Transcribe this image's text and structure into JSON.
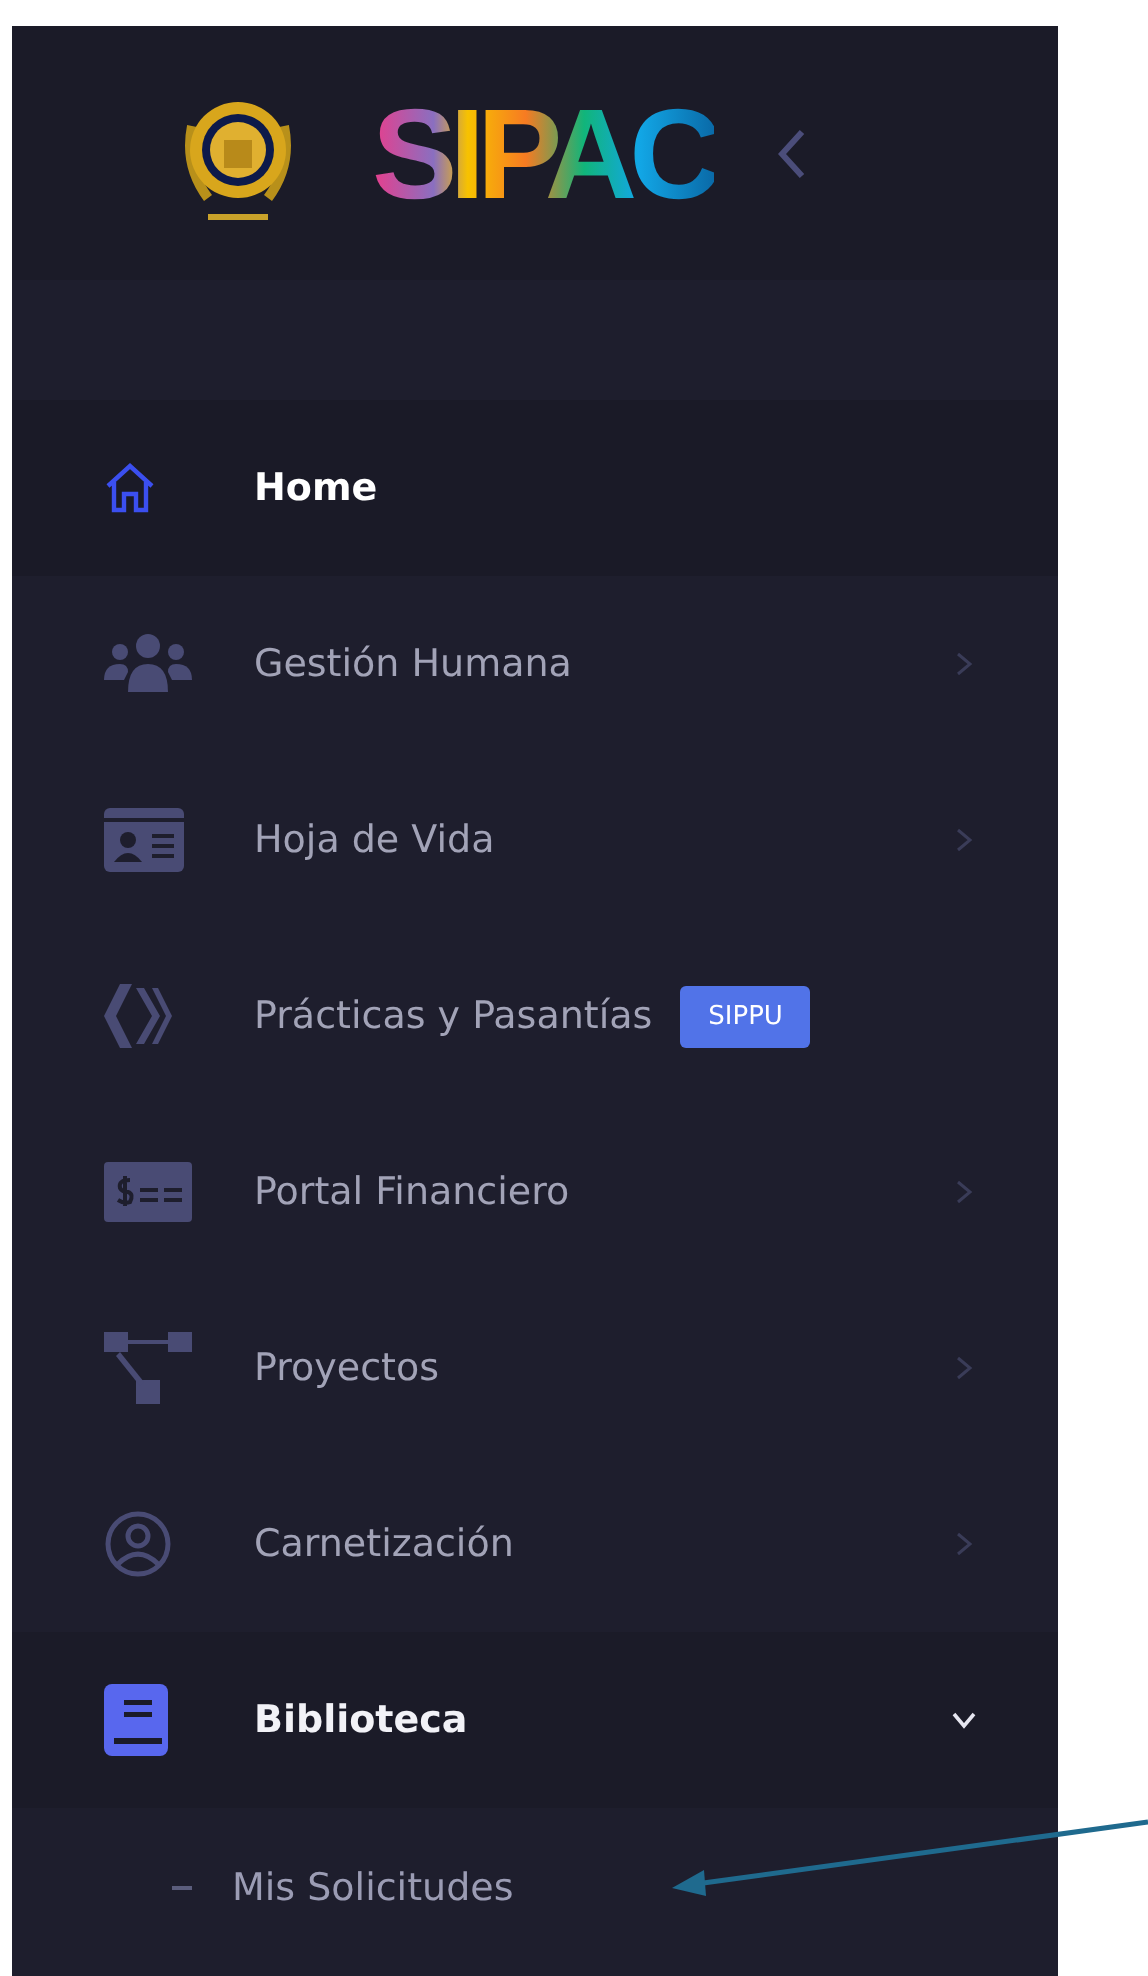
{
  "logo": {
    "text": "SIPAC"
  },
  "menu": [
    {
      "label": "Home",
      "selected": true
    },
    {
      "label": "Gestión Humana",
      "selected": false,
      "expanded": false
    },
    {
      "label": "Hoja de Vida",
      "selected": false,
      "expanded": false
    },
    {
      "label": "Prácticas y Pasantías",
      "selected": false,
      "badge": "SIPPU"
    },
    {
      "label": "Portal Financiero",
      "selected": false,
      "expanded": false
    },
    {
      "label": "Proyectos",
      "selected": false,
      "expanded": false
    },
    {
      "label": "Carnetización",
      "selected": false,
      "expanded": false
    },
    {
      "label": "Biblioteca",
      "selected": false,
      "expanded": true,
      "children": [
        {
          "label": "Mis Solicitudes"
        }
      ]
    }
  ]
}
